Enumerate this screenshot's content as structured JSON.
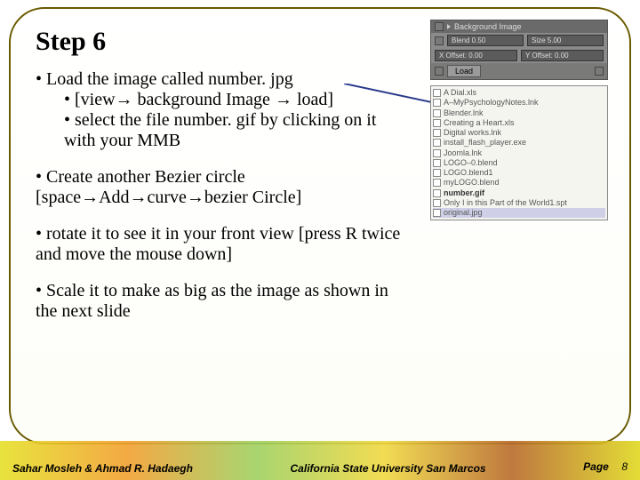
{
  "title": "Step 6",
  "bullets": {
    "b1": "Load the image called number. jpg",
    "b1a": "[view→ background Image → load]",
    "b1b": "select the file number. gif by clicking on it with your MMB",
    "b2": "Create another  Bezier circle [space→Add→curve→bezier Circle]",
    "b3": "rotate it to see it in your front view [press R twice and move the mouse down]",
    "b4": "Scale it to make as big as the image as shown in the next slide"
  },
  "panel": {
    "header": "Background Image",
    "blend_l": "Blend 0.50",
    "size_r": "Size 5.00",
    "xoff": "X Offset: 0.00",
    "yoff": "Y Offset: 0.00",
    "load": "Load"
  },
  "files": {
    "f0": "A Dial.xls",
    "f1": "A–MyPsychologyNotes.lnk",
    "f2": "Blender.lnk",
    "f3": "Creating a Heart.xls",
    "f4": "Digital works.lnk",
    "f5": "install_flash_player.exe",
    "f6": "Joomla.lnk",
    "f7": "LOGO–0.blend",
    "f8": "LOGO.blend1",
    "f9": "myLOGO.blend",
    "f10": "number.gif",
    "f11": "Only I in this Part of the World1.spt",
    "f12": "original.jpg"
  },
  "footer": {
    "authors": "Sahar Mosleh & Ahmad R. Hadaegh",
    "uni": "California State University San Marcos",
    "page_label": "Page",
    "page_num": "8"
  }
}
